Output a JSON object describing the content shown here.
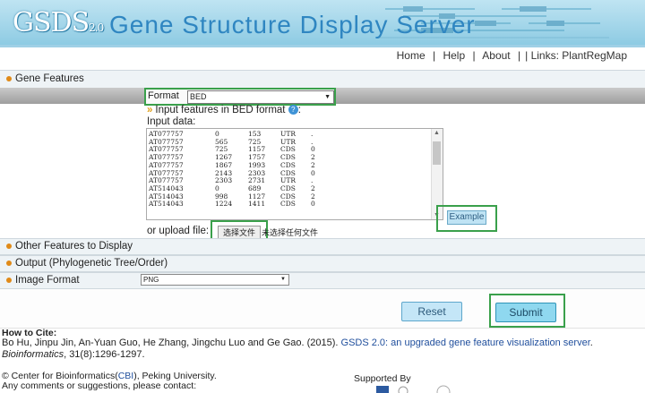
{
  "header": {
    "logo_main": "GSDS",
    "logo_version": "2.0",
    "title": "Gene Structure Display Server"
  },
  "nav": {
    "home": "Home",
    "help": "Help",
    "about": "About",
    "separator": "|",
    "links_label": "Links:",
    "link_1": "PlantRegMap"
  },
  "sections": {
    "gene_features": "Gene Features",
    "other_features": "Other Features to Display",
    "output": "Output (Phylogenetic Tree/Order)",
    "image_format": "Image Format"
  },
  "format": {
    "label": "Format",
    "value": "BED"
  },
  "input": {
    "heading": "Input features in BED format",
    "heading_suffix": ":",
    "data_label": "Input data:",
    "rows": [
      [
        "AT077757",
        "0",
        "153",
        "UTR",
        "."
      ],
      [
        "AT077757",
        "565",
        "725",
        "UTR",
        "."
      ],
      [
        "AT077757",
        "725",
        "1157",
        "CDS",
        "0"
      ],
      [
        "AT077757",
        "1267",
        "1757",
        "CDS",
        "2"
      ],
      [
        "AT077757",
        "1867",
        "1993",
        "CDS",
        "2"
      ],
      [
        "AT077757",
        "2143",
        "2303",
        "CDS",
        "0"
      ],
      [
        "AT077757",
        "2303",
        "2731",
        "UTR",
        "."
      ],
      [
        "AT514043",
        "0",
        "689",
        "CDS",
        "2"
      ],
      [
        "AT514043",
        "998",
        "1127",
        "CDS",
        "2"
      ],
      [
        "AT514043",
        "1224",
        "1411",
        "CDS",
        "0"
      ]
    ]
  },
  "buttons": {
    "example": "Example",
    "choose_file": "选择文件",
    "reset": "Reset",
    "submit": "Submit"
  },
  "upload": {
    "label": "or upload file:",
    "no_file": "未选择任何文件"
  },
  "image_format": {
    "value": "PNG"
  },
  "citation": {
    "title": "How to Cite:",
    "authors": "Bo Hu, Jinpu Jin, An-Yuan Guo, He Zhang, Jingchu Luo and Ge Gao. (2015). ",
    "link_text": "GSDS 2.0: an upgraded gene feature visualization server",
    "journal": "Bioinformatics",
    "rest": ", 31(8):1296-1297."
  },
  "footer": {
    "copyright_prefix": "© Center for Bioinformatics(",
    "cbi": "CBI",
    "copyright_suffix": "), Peking University.",
    "contact": "Any comments or suggestions, please contact:",
    "supported_by": "Supported By"
  },
  "colors": {
    "banner": "#8ecbe3",
    "title": "#2f86c1",
    "highlight_box": "#3aa04b",
    "section_dot": "#e08a18",
    "link": "#1f4e9c"
  }
}
